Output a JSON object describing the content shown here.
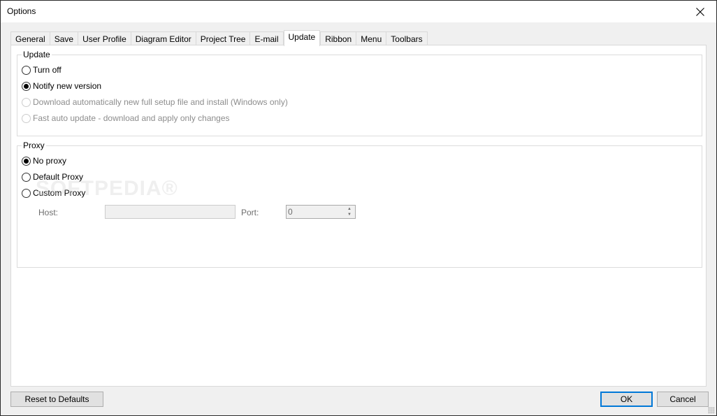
{
  "window": {
    "title": "Options",
    "close_icon": "close-icon"
  },
  "tabs": [
    {
      "label": "General",
      "active": false
    },
    {
      "label": "Save",
      "active": false
    },
    {
      "label": "User Profile",
      "active": false
    },
    {
      "label": "Diagram Editor",
      "active": false
    },
    {
      "label": "Project Tree",
      "active": false
    },
    {
      "label": "E-mail",
      "active": false
    },
    {
      "label": "Update",
      "active": true
    },
    {
      "label": "Ribbon",
      "active": false
    },
    {
      "label": "Menu",
      "active": false
    },
    {
      "label": "Toolbars",
      "active": false
    }
  ],
  "update_group": {
    "legend": "Update",
    "options": [
      {
        "label": "Turn off",
        "checked": false,
        "enabled": true
      },
      {
        "label": "Notify new version",
        "checked": true,
        "enabled": true
      },
      {
        "label": "Download automatically new full setup file and install (Windows only)",
        "checked": false,
        "enabled": false
      },
      {
        "label": "Fast auto update - download and apply only changes",
        "checked": false,
        "enabled": false
      }
    ]
  },
  "proxy_group": {
    "legend": "Proxy",
    "options": [
      {
        "label": "No proxy",
        "checked": true,
        "enabled": true
      },
      {
        "label": "Default Proxy",
        "checked": false,
        "enabled": true
      },
      {
        "label": "Custom Proxy",
        "checked": false,
        "enabled": true
      }
    ],
    "host_label": "Host:",
    "host_value": "",
    "port_label": "Port:",
    "port_value": "0"
  },
  "watermark": "SOFTPEDIA®",
  "buttons": {
    "reset": "Reset to Defaults",
    "ok": "OK",
    "cancel": "Cancel"
  },
  "colors": {
    "focus_border": "#0078d7",
    "window_bg": "#f0f0f0",
    "page_bg": "#ffffff",
    "disabled_text": "#8d8d8d"
  }
}
